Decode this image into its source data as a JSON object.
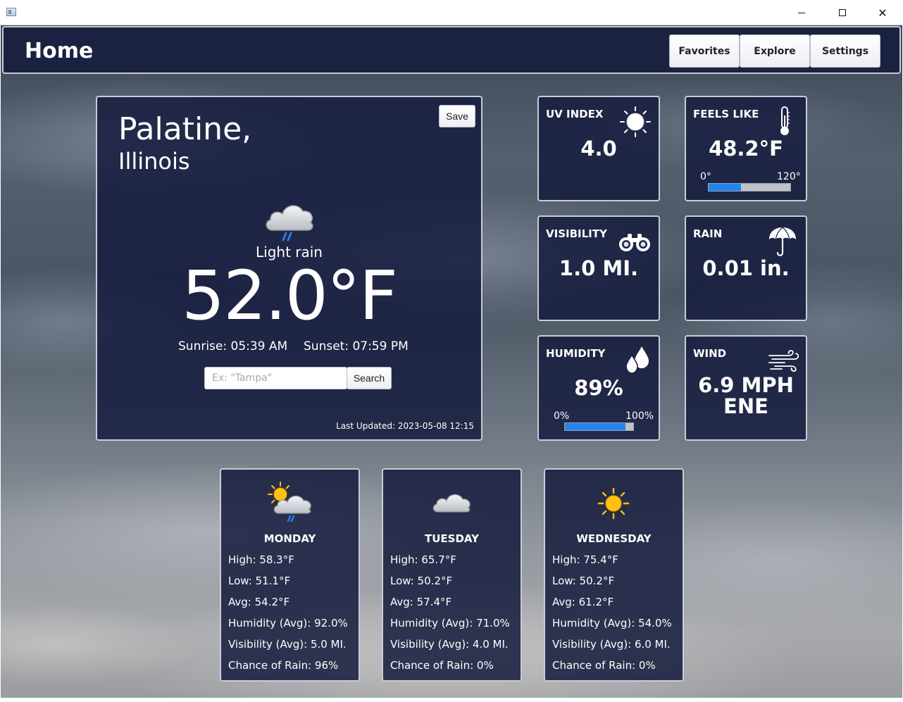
{
  "window": {
    "minimize_glyph": "",
    "close_glyph": "✕"
  },
  "header": {
    "title": "Home",
    "nav": [
      "Favorites",
      "Explore",
      "Settings"
    ]
  },
  "current": {
    "city": "Palatine,",
    "state": "Illinois",
    "save_label": "Save",
    "icon": "rain-cloud-icon",
    "condition": "Light rain",
    "temperature": "52.0°F",
    "sunrise": "Sunrise: 05:39 AM",
    "sunset": "Sunset: 07:59 PM",
    "search_placeholder": "Ex: \"Tampa\"",
    "search_value": "",
    "search_label": "Search",
    "last_updated": "Last Updated: 2023-05-08 12:15"
  },
  "metrics": {
    "uv": {
      "label": "UV INDEX",
      "value": "4.0",
      "icon": "sun-icon"
    },
    "feels_like": {
      "label": "FEELS LIKE",
      "value": "48.2°F",
      "icon": "thermometer-icon",
      "min_label": "0°",
      "max_label": "120°",
      "fraction": 0.4
    },
    "visibility": {
      "label": "VISIBILITY",
      "value": "1.0 MI.",
      "icon": "binoculars-icon"
    },
    "rain": {
      "label": "RAIN",
      "value": "0.01 in.",
      "icon": "umbrella-icon"
    },
    "humidity": {
      "label": "HUMIDITY",
      "value": "89%",
      "icon": "water-drops-icon",
      "min_label": "0%",
      "max_label": "100%",
      "fraction": 0.89
    },
    "wind": {
      "label": "WIND",
      "value": "6.9 MPH",
      "direction": "ENE",
      "icon": "wind-icon"
    }
  },
  "forecast": [
    {
      "day": "MONDAY",
      "icon": "sun-rain-cloud-icon",
      "high": "High: 58.3°F",
      "low": "Low: 51.1°F",
      "avg": "Avg: 54.2°F",
      "humidity": "Humidity (Avg): 92.0%",
      "visibility": "Visibility (Avg): 5.0 MI.",
      "rain_chance": "Chance of Rain: 96%"
    },
    {
      "day": "TUESDAY",
      "icon": "cloud-icon",
      "high": "High: 65.7°F",
      "low": "Low: 50.2°F",
      "avg": "Avg: 57.4°F",
      "humidity": "Humidity (Avg): 71.0%",
      "visibility": "Visibility (Avg): 4.0 MI.",
      "rain_chance": "Chance of Rain: 0%"
    },
    {
      "day": "WEDNESDAY",
      "icon": "sun-icon",
      "high": "High: 75.4°F",
      "low": "Low: 50.2°F",
      "avg": "Avg: 61.2°F",
      "humidity": "Humidity (Avg): 54.0%",
      "visibility": "Visibility (Avg): 6.0 MI.",
      "rain_chance": "Chance of Rain: 0%"
    }
  ],
  "colors": {
    "panel_bg": "#161c3e",
    "panel_border": "#c9ccd6",
    "bar_fill": "#1f86f0",
    "bar_track": "#bfc2c6",
    "sun": "#ffc20e"
  }
}
